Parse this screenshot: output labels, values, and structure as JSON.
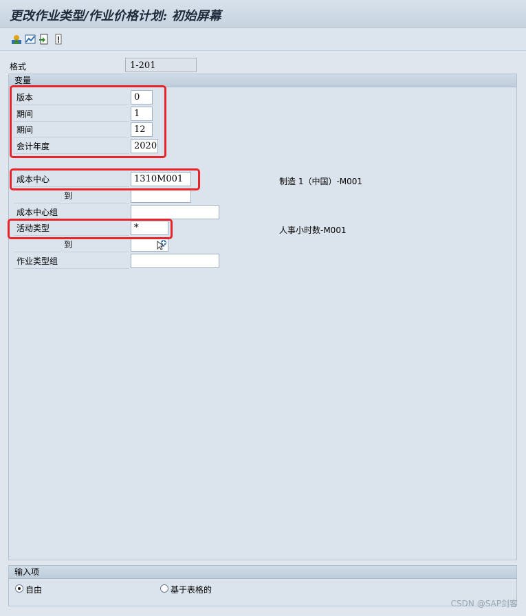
{
  "window": {
    "title": "更改作业类型/作业价格计划: 初始屏幕"
  },
  "toolbar": {
    "icons": [
      "overview-screen-icon",
      "graphic-icon",
      "document-icon",
      "info-icon"
    ]
  },
  "layout_field": {
    "label": "格式",
    "value": "1-201"
  },
  "variables": {
    "header": "变量",
    "rows": [
      {
        "label": "版本",
        "value": "0"
      },
      {
        "label": "期间",
        "value": "1"
      },
      {
        "label": "期间",
        "value": "12"
      },
      {
        "label": "会计年度",
        "value": "2020"
      }
    ],
    "cost_center": {
      "label": "成本中心",
      "value": "1310M001",
      "description": "制造 1（中国）-M001"
    },
    "cost_center_to": {
      "label": "到",
      "value": ""
    },
    "cost_center_group": {
      "label": "成本中心组",
      "value": ""
    },
    "activity_type": {
      "label": "活动类型",
      "value": "*",
      "description": "人事小时数-M001"
    },
    "activity_type_to": {
      "label": "到",
      "value": ""
    },
    "activity_type_group": {
      "label": "作业类型组",
      "value": ""
    }
  },
  "entry": {
    "header": "输入项",
    "options": [
      {
        "label": "自由",
        "selected": true
      },
      {
        "label": "基于表格的",
        "selected": false
      }
    ]
  },
  "watermark": "CSDN @SAP剑客",
  "colors": {
    "highlight": "#e8232a",
    "panel": "#dbe4ec"
  }
}
